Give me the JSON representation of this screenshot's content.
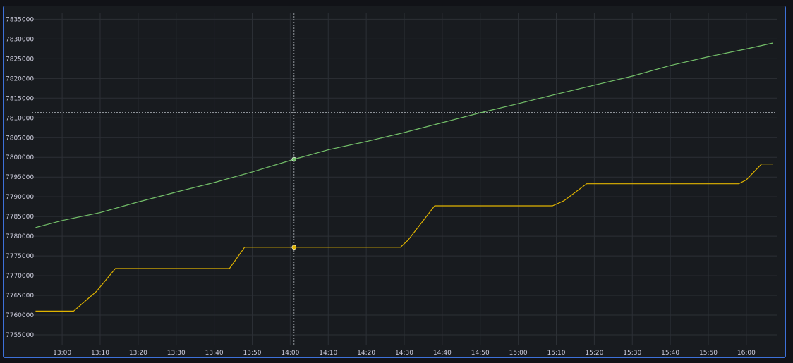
{
  "chart_data": {
    "type": "line",
    "title": "",
    "xlabel": "",
    "ylabel": "",
    "grid": true,
    "legend": "none",
    "xlim": [
      "12:52",
      "16:08"
    ],
    "ylim": [
      7752500,
      7836500
    ],
    "y_ticks": [
      "7755000",
      "7760000",
      "7765000",
      "7770000",
      "7775000",
      "7780000",
      "7785000",
      "7790000",
      "7795000",
      "7800000",
      "7805000",
      "7810000",
      "7815000",
      "7820000",
      "7825000",
      "7830000",
      "7835000"
    ],
    "x_ticks": [
      "13:00",
      "13:10",
      "13:20",
      "13:30",
      "13:40",
      "13:50",
      "14:00",
      "14:10",
      "14:20",
      "14:30",
      "14:40",
      "14:50",
      "15:00",
      "15:10",
      "15:20",
      "15:30",
      "15:40",
      "15:50",
      "16:00"
    ],
    "crosshair": {
      "x": "14:01",
      "y": 7811400
    },
    "series": [
      {
        "color": "#73bf69",
        "hover_point": {
          "x": "14:01",
          "y": 7799500
        },
        "points": [
          [
            "12:53",
            7782200
          ],
          [
            "13:00",
            7784000
          ],
          [
            "13:10",
            7786000
          ],
          [
            "13:20",
            7788700
          ],
          [
            "13:30",
            7791200
          ],
          [
            "13:40",
            7793600
          ],
          [
            "13:50",
            7796300
          ],
          [
            "14:01",
            7799500
          ],
          [
            "14:10",
            7801900
          ],
          [
            "14:20",
            7804000
          ],
          [
            "14:30",
            7806300
          ],
          [
            "14:40",
            7808800
          ],
          [
            "14:50",
            7811300
          ],
          [
            "15:00",
            7813600
          ],
          [
            "15:10",
            7816000
          ],
          [
            "15:20",
            7818300
          ],
          [
            "15:30",
            7820600
          ],
          [
            "15:40",
            7823300
          ],
          [
            "15:50",
            7825500
          ],
          [
            "16:00",
            7827500
          ],
          [
            "16:07",
            7829000
          ]
        ]
      },
      {
        "color": "#e0b400",
        "hover_point": {
          "x": "14:01",
          "y": 7777200
        },
        "points": [
          [
            "12:53",
            7761000
          ],
          [
            "13:03",
            7761000
          ],
          [
            "13:09",
            7766000
          ],
          [
            "13:14",
            7771800
          ],
          [
            "13:20",
            7771800
          ],
          [
            "13:30",
            7771800
          ],
          [
            "13:44",
            7771800
          ],
          [
            "13:48",
            7777200
          ],
          [
            "14:01",
            7777200
          ],
          [
            "14:20",
            7777200
          ],
          [
            "14:29",
            7777200
          ],
          [
            "14:31",
            7779000
          ],
          [
            "14:38",
            7787700
          ],
          [
            "15:00",
            7787700
          ],
          [
            "15:09",
            7787700
          ],
          [
            "15:12",
            7789000
          ],
          [
            "15:18",
            7793300
          ],
          [
            "15:40",
            7793300
          ],
          [
            "15:58",
            7793300
          ],
          [
            "16:00",
            7794300
          ],
          [
            "16:04",
            7798300
          ],
          [
            "16:07",
            7798300
          ]
        ]
      }
    ]
  }
}
